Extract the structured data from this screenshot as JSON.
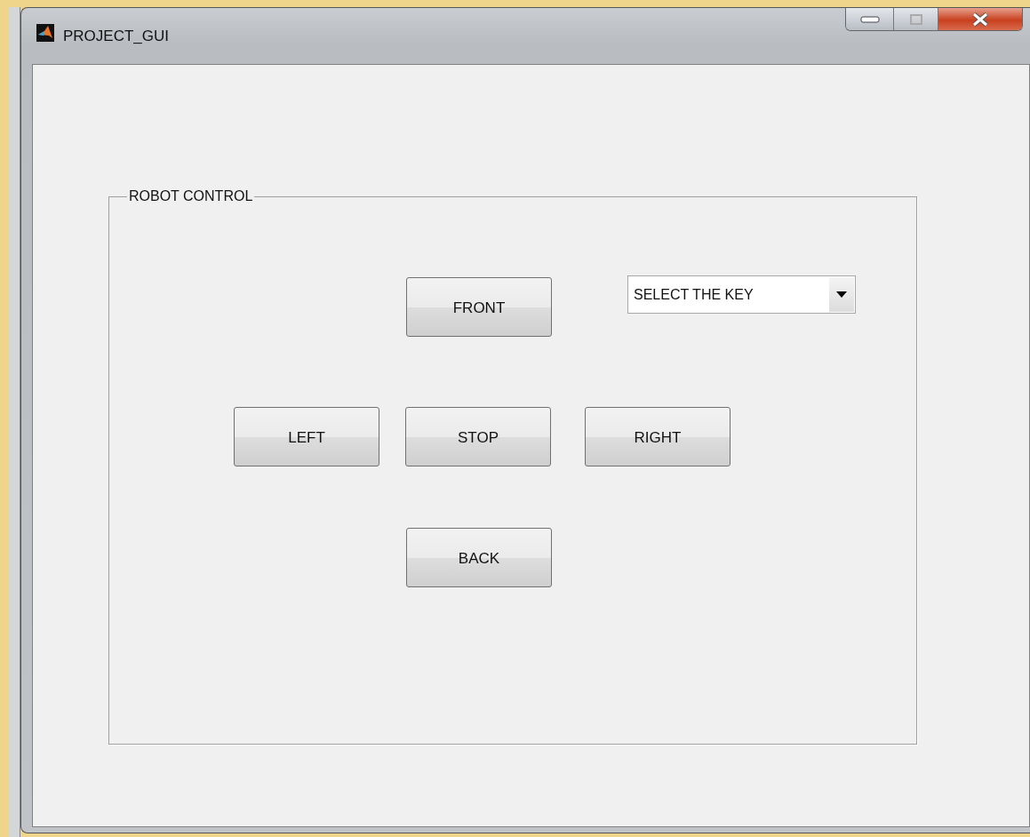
{
  "window": {
    "title": "PROJECT_GUI"
  },
  "panel": {
    "title": "ROBOT CONTROL"
  },
  "rows": [
    {
      "buttons": [
        {
          "label": "FRONT"
        }
      ],
      "dropdown": {
        "value": "SELECT THE KEY"
      }
    },
    {
      "buttons": [
        {
          "label": "LEFT"
        },
        {
          "label": "STOP"
        },
        {
          "label": "RIGHT"
        }
      ]
    },
    {
      "buttons": [
        {
          "label": "BACK"
        }
      ]
    }
  ]
}
